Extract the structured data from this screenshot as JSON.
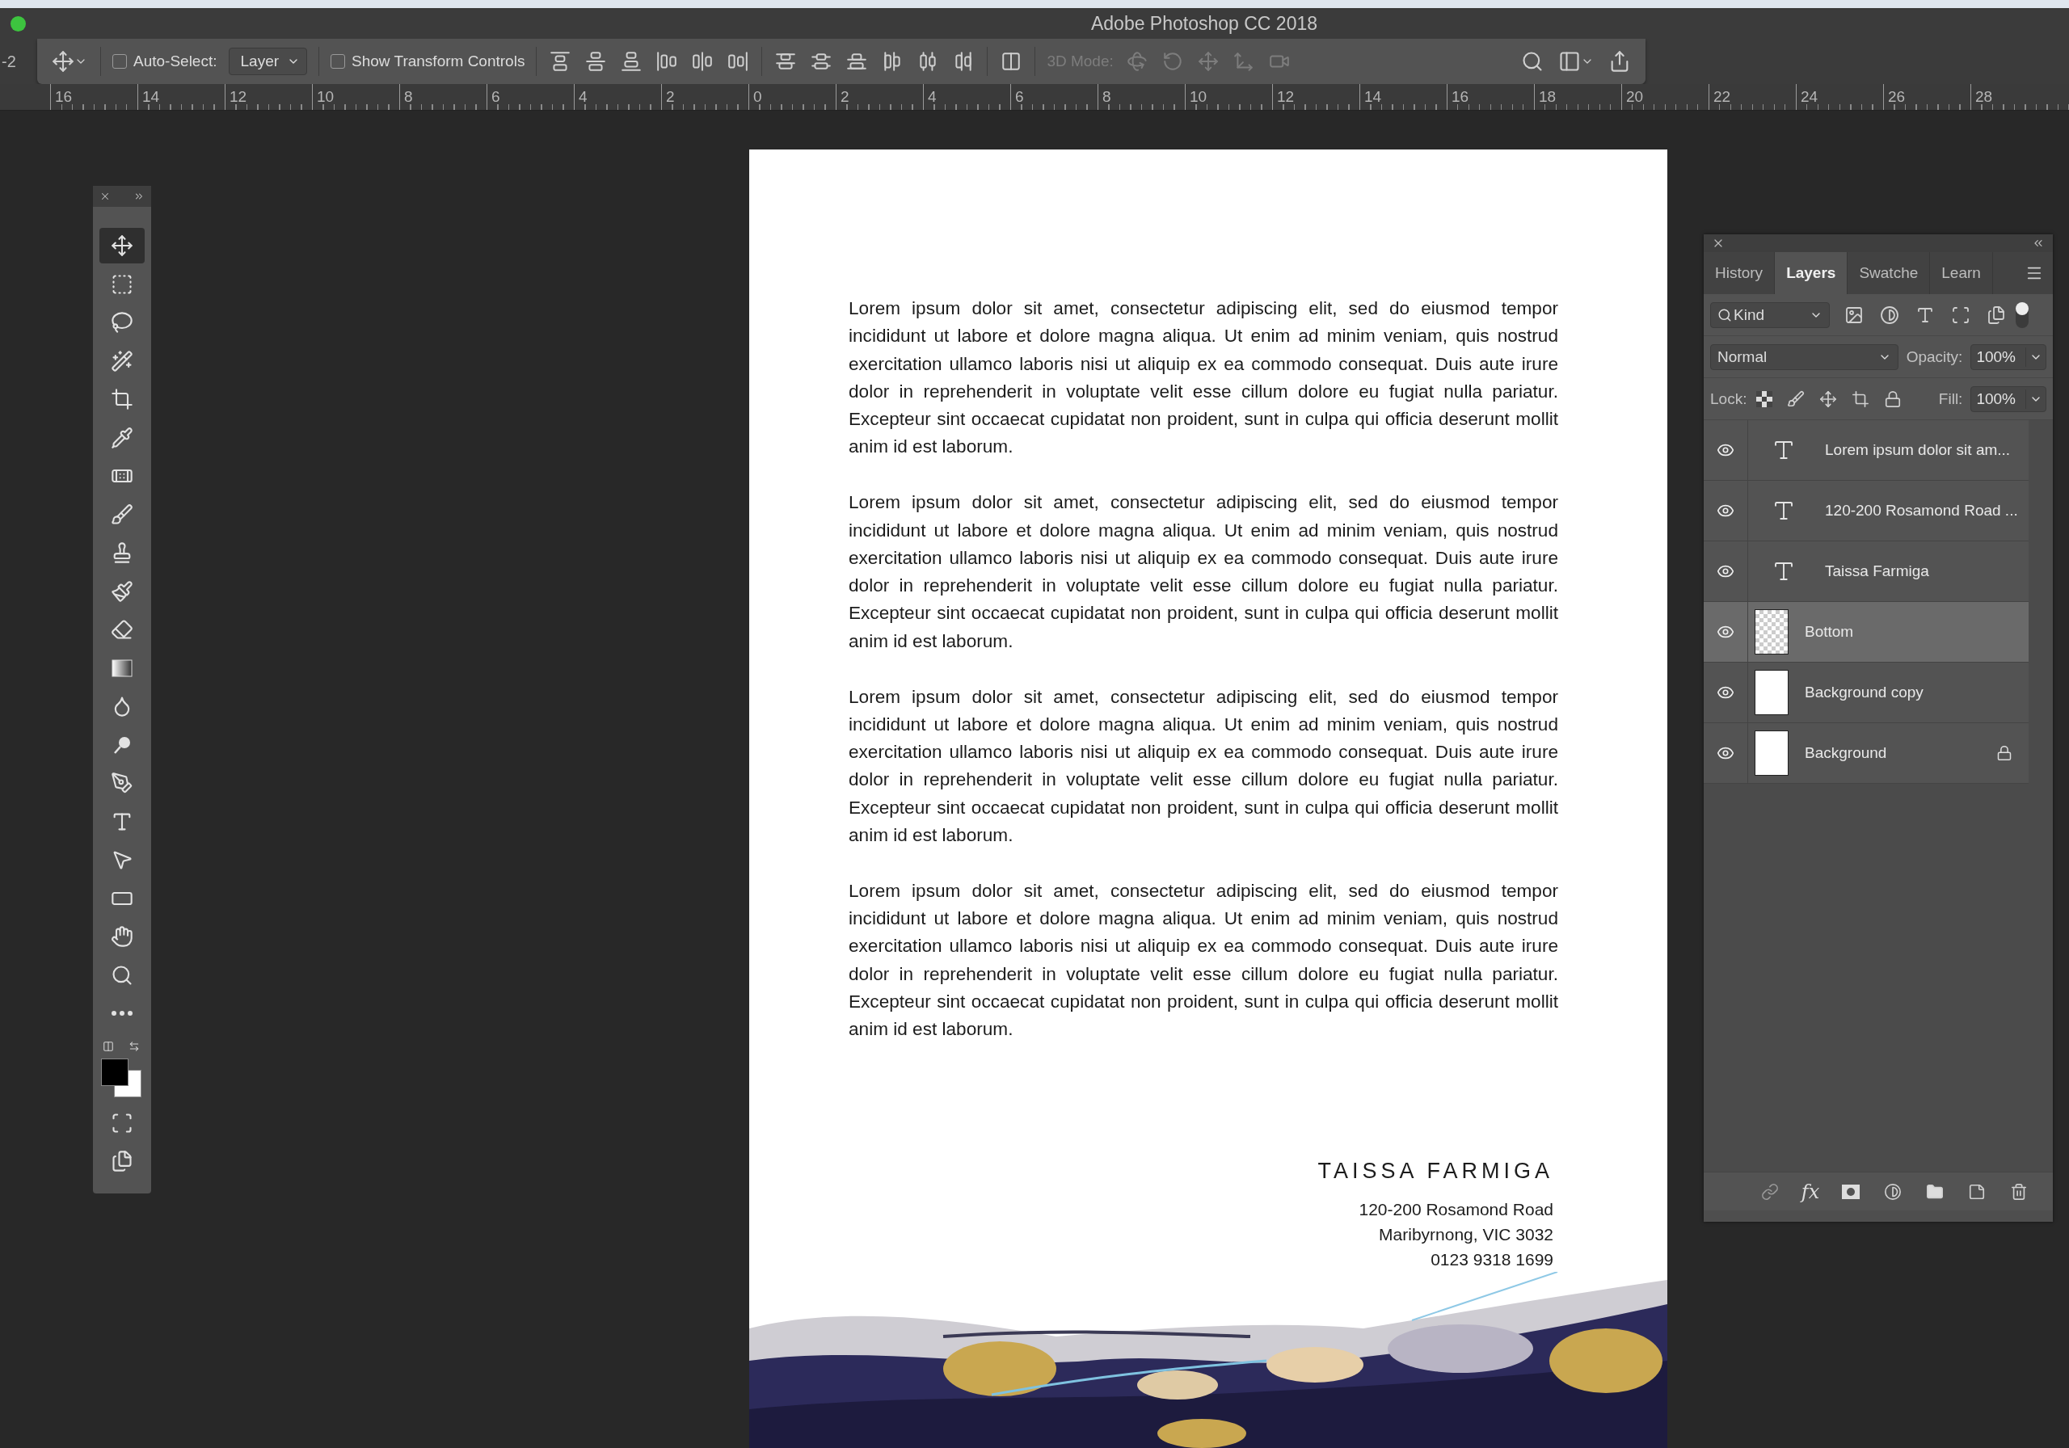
{
  "title_bar": {
    "title": "Adobe Photoshop CC 2018"
  },
  "options_bar": {
    "edge_text": "-2",
    "auto_select": {
      "label": "Auto-Select:",
      "checked": false
    },
    "auto_select_target": "Layer",
    "show_transform_controls": {
      "label": "Show Transform Controls",
      "checked": false
    },
    "mode_3d": {
      "label": "3D Mode:",
      "disabled": true
    }
  },
  "ruler": {
    "labels": [
      "16",
      "14",
      "12",
      "10",
      "8",
      "6",
      "4",
      "2",
      "0",
      "2",
      "4",
      "6",
      "8",
      "10",
      "12",
      "14",
      "16",
      "18",
      "20",
      "22",
      "24",
      "26",
      "28"
    ]
  },
  "tools": [
    {
      "selected": true
    },
    {
      "selected": false
    },
    {
      "selected": false
    },
    {
      "selected": false
    },
    {
      "selected": false
    },
    {
      "selected": false
    },
    {
      "selected": false
    },
    {
      "selected": false
    },
    {
      "selected": false
    },
    {
      "selected": false
    },
    {
      "selected": false
    },
    {
      "selected": false
    },
    {
      "selected": false
    },
    {
      "selected": false
    },
    {
      "selected": false
    },
    {
      "selected": false
    },
    {
      "selected": false
    },
    {
      "selected": false
    },
    {
      "selected": false
    },
    {
      "selected": false
    },
    {
      "selected": false
    }
  ],
  "document": {
    "paragraphs": [
      "Lorem ipsum dolor sit amet, consectetur adipiscing elit, sed do eiusmod tempor incididunt ut labore et dolore magna aliqua. Ut enim ad minim veniam, quis nostrud exercitation ullamco laboris nisi ut aliquip ex ea commodo consequat. Duis aute irure dolor in reprehenderit in voluptate velit esse cillum dolore eu fugiat nulla pariatur. Excepteur sint occaecat cupidatat non proident, sunt in culpa qui officia deserunt mollit anim id est laborum.",
      "Lorem ipsum dolor sit amet, consectetur adipiscing elit, sed do eiusmod tempor incididunt ut labore et dolore magna aliqua. Ut enim ad minim veniam, quis nostrud exercitation ullamco laboris nisi ut aliquip ex ea commodo consequat. Duis aute irure dolor in reprehenderit in voluptate velit esse cillum dolore eu fugiat nulla pariatur. Excepteur sint occaecat cupidatat non proident, sunt in culpa qui officia deserunt mollit anim id est laborum.",
      "Lorem ipsum dolor sit amet, consectetur adipiscing elit, sed do eiusmod tempor incididunt ut labore et dolore magna aliqua. Ut enim ad minim veniam, quis nostrud exercitation ullamco laboris nisi ut aliquip ex ea commodo consequat. Duis aute irure dolor in reprehenderit in voluptate velit esse cillum dolore eu fugiat nulla pariatur. Excepteur sint occaecat cupidatat non proident, sunt in culpa qui officia deserunt mollit anim id est laborum.",
      "Lorem ipsum dolor sit amet, consectetur adipiscing elit, sed do eiusmod tempor incididunt ut labore et dolore magna aliqua. Ut enim ad minim veniam, quis nostrud exercitation ullamco laboris nisi ut aliquip ex ea commodo consequat. Duis aute irure dolor in reprehenderit in voluptate velit esse cillum dolore eu fugiat nulla pariatur. Excepteur sint occaecat cupidatat non proident, sunt in culpa qui officia deserunt mollit anim id est laborum."
    ],
    "signature": {
      "name": "TAISSA FARMIGA",
      "address_lines": [
        "120-200 Rosamond Road",
        "Maribyrnong, VIC 3032",
        "0123 9318 1699"
      ]
    }
  },
  "layers_panel": {
    "tabs": [
      {
        "label": "History",
        "selected": false
      },
      {
        "label": "Layers",
        "selected": true
      },
      {
        "label": "Swatche",
        "selected": false
      },
      {
        "label": "Learn",
        "selected": false
      }
    ],
    "filter": "Kind",
    "blend_mode": "Normal",
    "opacity_label": "Opacity:",
    "opacity": "100%",
    "lock_label": "Lock:",
    "fill_label": "Fill:",
    "fill": "100%",
    "layers": [
      {
        "kind": "text",
        "name": "Lorem ipsum dolor sit am...",
        "visible": true,
        "selected": false,
        "locked": false
      },
      {
        "kind": "text",
        "name": "120-200 Rosamond Road ...",
        "visible": true,
        "selected": false,
        "locked": false
      },
      {
        "kind": "text",
        "name": "Taissa Farmiga",
        "visible": true,
        "selected": false,
        "locked": false
      },
      {
        "kind": "transparent",
        "name": "Bottom",
        "visible": true,
        "selected": true,
        "locked": false
      },
      {
        "kind": "solid",
        "name": "Background copy",
        "visible": true,
        "selected": false,
        "locked": false
      },
      {
        "kind": "solid",
        "name": "Background",
        "visible": true,
        "selected": false,
        "locked": true
      }
    ],
    "footer_fx": "fx"
  }
}
